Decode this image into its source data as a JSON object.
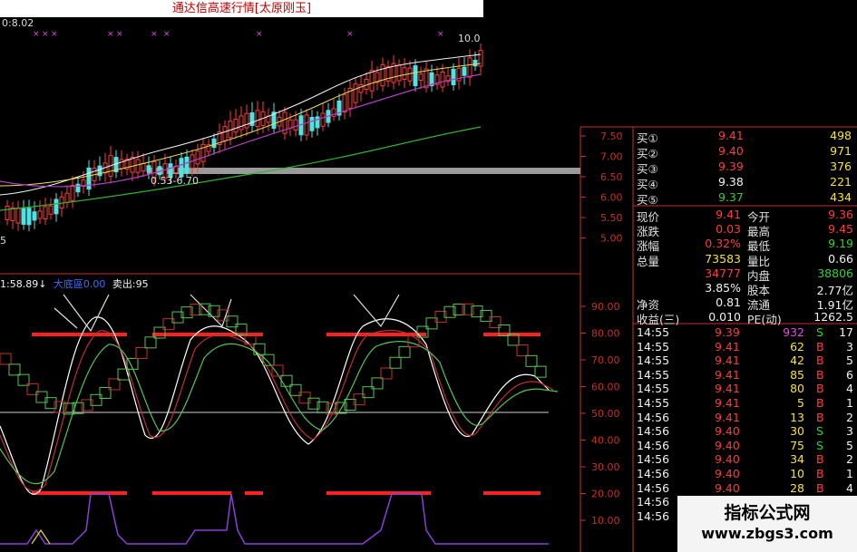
{
  "title": "通达信高速行情[太原刚玉]",
  "top_left_value": "0:8.02",
  "price_high_label": "10.0",
  "mid_annotation": "0.53-6.70",
  "left_annotation": "5",
  "indicator_header": {
    "value": "1:58.89",
    "arrow": "↓",
    "series1": "大底區0.00",
    "series2": "卖出:95"
  },
  "price_axis": [
    "7.50",
    "7.00",
    "6.50",
    "6.00",
    "5.50",
    "5.00"
  ],
  "indicator_axis": [
    "90.00",
    "80.00",
    "70.00",
    "60.00",
    "50.00",
    "40.00",
    "30.00",
    "20.00",
    "10.00"
  ],
  "order_book": [
    {
      "label": "买①",
      "price": "9.41",
      "vol": "498"
    },
    {
      "label": "买②",
      "price": "9.40",
      "vol": "971"
    },
    {
      "label": "买③",
      "price": "9.39",
      "vol": "376"
    },
    {
      "label": "买④",
      "price": "9.38",
      "vol": "221"
    },
    {
      "label": "买⑤",
      "price": "9.37",
      "vol": "434"
    }
  ],
  "quote": [
    {
      "l1": "现价",
      "v1": "9.41",
      "l2": "今开",
      "v2": "9.36"
    },
    {
      "l1": "涨跌",
      "v1": "0.03",
      "l2": "最高",
      "v2": "9.45"
    },
    {
      "l1": "涨幅",
      "v1": "0.32%",
      "l2": "最低",
      "v2": "9.19"
    },
    {
      "l1": "总量",
      "v1": "73583",
      "l2": "量比",
      "v2": "0.66"
    },
    {
      "l1": "",
      "v1": "34777",
      "l2": "内盘",
      "v2": "38806"
    },
    {
      "l1": "",
      "v1": "3.85%",
      "l2": "股本",
      "v2": "2.77亿"
    },
    {
      "l1": "净资",
      "v1": "0.81",
      "l2": "流通",
      "v2": "1.91亿"
    },
    {
      "l1": "收益(三)",
      "v1": "0.010",
      "l2": "PE(动)",
      "v2": "1262.5"
    }
  ],
  "ticks": [
    {
      "time": "14:55",
      "price": "9.39",
      "vol": "932",
      "side": "S",
      "n": "17"
    },
    {
      "time": "14:55",
      "price": "9.41",
      "vol": "62",
      "side": "B",
      "n": "3"
    },
    {
      "time": "14:55",
      "price": "9.41",
      "vol": "42",
      "side": "B",
      "n": "5"
    },
    {
      "time": "14:55",
      "price": "9.41",
      "vol": "85",
      "side": "B",
      "n": "6"
    },
    {
      "time": "14:55",
      "price": "9.41",
      "vol": "80",
      "side": "B",
      "n": "4"
    },
    {
      "time": "14:55",
      "price": "9.41",
      "vol": "5",
      "side": "B",
      "n": "1"
    },
    {
      "time": "14:56",
      "price": "9.41",
      "vol": "13",
      "side": "B",
      "n": "2"
    },
    {
      "time": "14:56",
      "price": "9.40",
      "vol": "30",
      "side": "S",
      "n": "3"
    },
    {
      "time": "14:56",
      "price": "9.40",
      "vol": "75",
      "side": "S",
      "n": "5"
    },
    {
      "time": "14:56",
      "price": "9.40",
      "vol": "34",
      "side": "B",
      "n": "2"
    },
    {
      "time": "14:56",
      "price": "9.40",
      "vol": "10",
      "side": "B",
      "n": "1"
    },
    {
      "time": "14:56",
      "price": "9.40",
      "vol": "28",
      "side": "B",
      "n": "4"
    },
    {
      "time": "14:56",
      "price": "",
      "vol": "",
      "side": "",
      "n": ""
    },
    {
      "time": "14:56",
      "price": "",
      "vol": "",
      "side": "",
      "n": ""
    }
  ],
  "watermark": {
    "cn": "指标公式网",
    "url": "www.zbgs3.com"
  },
  "colors": {
    "up": "#ff3b3b",
    "down": "#4fe3e3",
    "axis": "#c8302a",
    "bg": "#000000"
  }
}
